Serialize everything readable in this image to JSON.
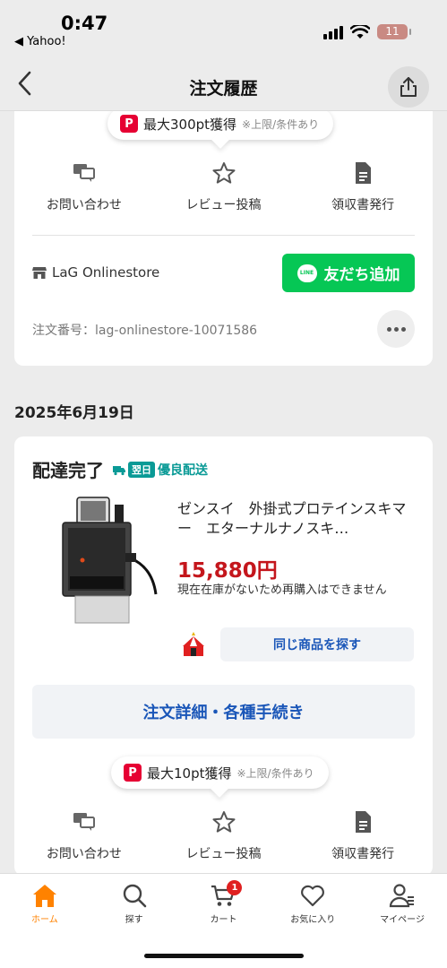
{
  "statusbar": {
    "time": "0:47",
    "back_app": "◀ Yahoo!",
    "battery": "11"
  },
  "header": {
    "title": "注文履歴"
  },
  "order1": {
    "points": {
      "text": "最大300pt獲得",
      "note": "※上限/条件あり"
    },
    "actions": [
      {
        "label": "お問い合わせ",
        "icon": "chat-icon"
      },
      {
        "label": "レビュー投稿",
        "icon": "star-icon"
      },
      {
        "label": "領収書発行",
        "icon": "document-icon"
      }
    ],
    "store": "LaG Onlinestore",
    "line_button": "友だち追加",
    "line_logo": "LINE",
    "order_number": "注文番号：lag-onlinestore-10071586"
  },
  "order2": {
    "date": "2025年6月19日",
    "status": "配達完了",
    "delivery_badge": {
      "box": "翌日",
      "text": "優良配送"
    },
    "product": {
      "name": "ゼンスイ　外掛式プロテインスキマー　エターナルナノスキ…",
      "price": "15,880円",
      "note": "現在在庫がないため再購入はできません"
    },
    "same_button": "同じ商品を探す",
    "detail_button": "注文詳細・各種手続き",
    "points": {
      "text": "最大10pt獲得",
      "note": "※上限/条件あり"
    },
    "actions": [
      {
        "label": "お問い合わせ",
        "icon": "chat-icon"
      },
      {
        "label": "レビュー投稿",
        "icon": "star-icon"
      },
      {
        "label": "領収書発行",
        "icon": "document-icon"
      }
    ]
  },
  "tabbar": {
    "tabs": [
      {
        "label": "ホーム",
        "icon": "home-icon",
        "active": true
      },
      {
        "label": "探す",
        "icon": "search-icon"
      },
      {
        "label": "カート",
        "icon": "cart-icon",
        "badge": "1"
      },
      {
        "label": "お気に入り",
        "icon": "heart-icon"
      },
      {
        "label": "マイページ",
        "icon": "user-icon"
      }
    ]
  },
  "colors": {
    "line_green": "#06c755",
    "price_red": "#c4161c",
    "link_blue": "#1a56b8",
    "active_orange": "#ff8200",
    "paypay_red": "#e60033"
  }
}
